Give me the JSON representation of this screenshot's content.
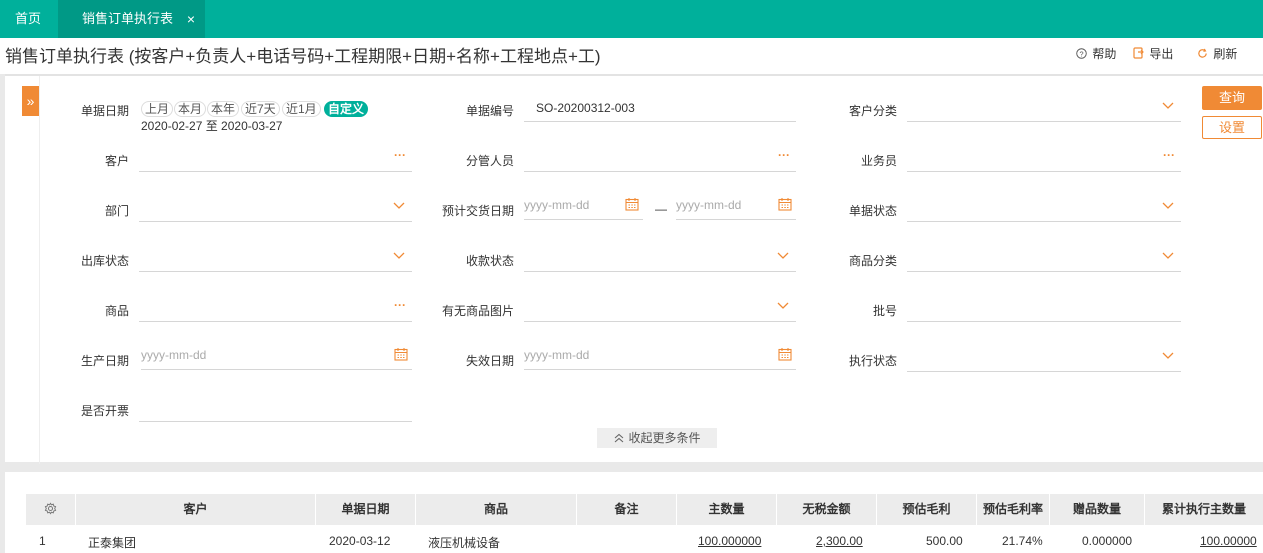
{
  "tabs": {
    "home": "首页",
    "active": "销售订单执行表",
    "close": "×"
  },
  "page": {
    "title": "销售订单执行表 (按客户+负责人+电话号码+工程期限+日期+名称+工程地点+工)"
  },
  "toolbar": {
    "help": "帮助",
    "export": "导出",
    "refresh": "刷新"
  },
  "filters": {
    "bill_date_label": "单据日期",
    "date_chips": [
      "上月",
      "本月",
      "本年",
      "近7天",
      "近1月",
      "自定义"
    ],
    "date_range": "2020-02-27 至 2020-03-27",
    "bill_no_label": "单据编号",
    "bill_no_value": "SO-20200312-003",
    "customer_category_label": "客户分类",
    "customer_label": "客户",
    "manager_label": "分管人员",
    "salesman_label": "业务员",
    "department_label": "部门",
    "expected_delivery_label": "预计交货日期",
    "date_placeholder": "yyyy-mm-dd",
    "range_dash": "—",
    "bill_status_label": "单据状态",
    "outbound_status_label": "出库状态",
    "payment_status_label": "收款状态",
    "product_category_label": "商品分类",
    "product_label": "商品",
    "has_image_label": "有无商品图片",
    "batch_label": "批号",
    "production_date_label": "生产日期",
    "expiry_date_label": "失效日期",
    "exec_status_label": "执行状态",
    "invoiced_label": "是否开票",
    "query_button": "查询",
    "setting_button": "设置",
    "collapse_button": "收起更多条件",
    "expander": "»",
    "dots": "···"
  },
  "grid": {
    "columns": [
      "客户",
      "单据日期",
      "商品",
      "备注",
      "主数量",
      "无税金额",
      "预估毛利",
      "预估毛利率",
      "赠品数量",
      "累计执行主数量"
    ],
    "rows": [
      {
        "index": "1",
        "customer": "正泰集团",
        "date": "2020-03-12",
        "product": "液压机械设备",
        "note": "",
        "qty": "100.000000",
        "amount": "2,300.00",
        "profit": "500.00",
        "profit_rate": "21.74%",
        "gift_qty": "0.000000",
        "exec_qty": "100.00000"
      }
    ]
  }
}
